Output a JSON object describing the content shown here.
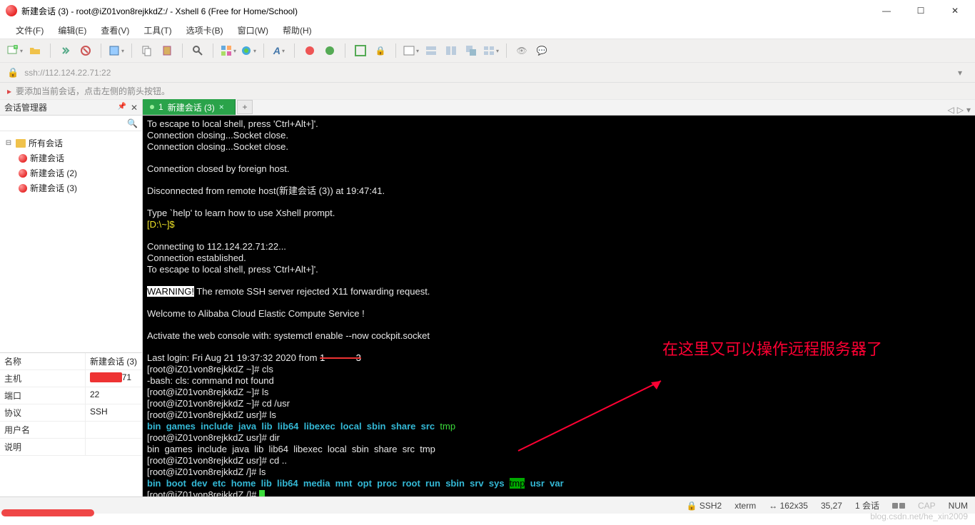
{
  "window": {
    "title": "新建会话 (3) - root@iZ01von8rejkkdZ:/ - Xshell 6 (Free for Home/School)"
  },
  "menu": [
    "文件(F)",
    "编辑(E)",
    "查看(V)",
    "工具(T)",
    "选项卡(B)",
    "窗口(W)",
    "帮助(H)"
  ],
  "addressbar": {
    "url": "ssh://112.124.22.71:22"
  },
  "infobar": {
    "message": "要添加当前会话，点击左侧的箭头按钮。"
  },
  "sidebar": {
    "title": "会话管理器",
    "root": "所有会话",
    "items": [
      "新建会话",
      "新建会话 (2)",
      "新建会话 (3)"
    ]
  },
  "properties": [
    {
      "k": "名称",
      "v": "新建会话 (3)"
    },
    {
      "k": "主机",
      "v": "71",
      "masked": true
    },
    {
      "k": "端口",
      "v": "22"
    },
    {
      "k": "协议",
      "v": "SSH"
    },
    {
      "k": "用户名",
      "v": ""
    },
    {
      "k": "说明",
      "v": ""
    }
  ],
  "tab": {
    "number": "1",
    "label": "新建会话 (3)"
  },
  "terminal": {
    "escape_hint": "To escape to local shell, press 'Ctrl+Alt+]'.",
    "closing1": "Connection closing...Socket close.",
    "closing2": "Connection closing...Socket close.",
    "closed_by": "Connection closed by foreign host.",
    "disconnected": "Disconnected from remote host(新建会话 (3)) at 19:47:41.",
    "help_hint": "Type `help' to learn how to use Xshell prompt.",
    "local_prompt": "[D:\\~]$",
    "connecting": "Connecting to 112.124.22.71:22...",
    "established": "Connection established.",
    "escape_hint2": "To escape to local shell, press 'Ctrl+Alt+]'.",
    "warning_label": "WARNING!",
    "warning_text": " The remote SSH server rejected X11 forwarding request.",
    "welcome": "Welcome to Alibaba Cloud Elastic Compute Service !",
    "activate": "Activate the web console with: systemctl enable --now cockpit.socket",
    "last_login_pre": "Last login: Fri Aug 21 19:37:32 2020 from ",
    "last_login_red": "1            3",
    "p_home": "[root@iZ01von8rejkkdZ ~]# ",
    "p_usr": "[root@iZ01von8rejkkdZ usr]# ",
    "p_root": "[root@iZ01von8rejkkdZ /]# ",
    "cls": "cls",
    "cls_err": "-bash: cls: command not found",
    "ls": "ls",
    "cd_usr": "cd /usr",
    "dir": "dir",
    "cd_up": "cd ..",
    "usr_list": "bin  games  include  java  lib  lib64  libexec  local  sbin  share  src  ",
    "usr_tmp": "tmp",
    "usr_list_plain": "bin  games  include  java  lib  lib64  libexec  local  sbin  share  src  tmp",
    "root_list_a": "bin  boot  dev  etc  home  lib  lib64  media  mnt  opt  proc  root  run  sbin  srv  sys  ",
    "root_tmp": "tmp",
    "root_list_b": "  usr  var"
  },
  "annotation": "在这里又可以操作远程服务器了",
  "status": {
    "ssh": "SSH2",
    "term": "xterm",
    "size": "162x35",
    "pos": "35,27",
    "sessions": "1 会话",
    "cap": "CAP",
    "num": "NUM"
  },
  "watermark": "blog.csdn.net/he_xin2009"
}
